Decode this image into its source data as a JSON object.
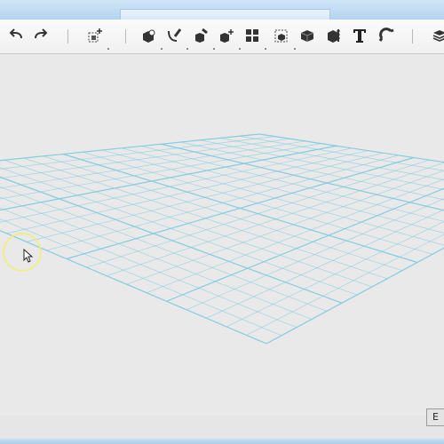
{
  "toolbar": {
    "groups": [
      {
        "items": [
          {
            "name": "undo-icon"
          },
          {
            "name": "redo-icon"
          }
        ]
      },
      {
        "items": [
          {
            "name": "add-shape-icon"
          }
        ]
      },
      {
        "items": [
          {
            "name": "primitive-shape-icon"
          },
          {
            "name": "sketch-icon"
          },
          {
            "name": "construct-icon"
          },
          {
            "name": "modify-icon"
          },
          {
            "name": "pattern-icon"
          },
          {
            "name": "group-icon"
          },
          {
            "name": "combine-icon"
          },
          {
            "name": "measure-icon"
          },
          {
            "name": "text-icon",
            "glyph": "T"
          },
          {
            "name": "snap-icon"
          }
        ]
      },
      {
        "items": [
          {
            "name": "material-icon"
          }
        ]
      }
    ]
  },
  "viewport": {
    "grid_color": "#7fcbe0",
    "background": "#e9e9e9",
    "cursor_highlight_color": "#f2ec7c"
  },
  "status": {
    "corner_label": "E"
  }
}
